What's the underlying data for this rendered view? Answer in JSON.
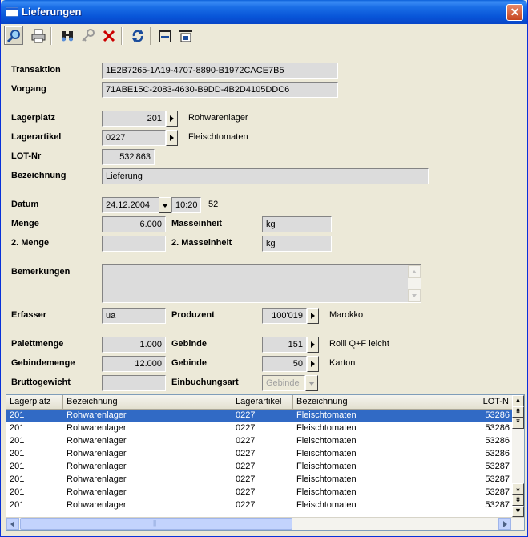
{
  "window": {
    "title": "Lieferungen",
    "close": "✕"
  },
  "toolbar": {
    "buttons": [
      "search-icon",
      "print-icon",
      "binoculars-icon",
      "key-icon",
      "delete-icon",
      "refresh-icon",
      "split-icon",
      "import-icon"
    ]
  },
  "form": {
    "transaktion_label": "Transaktion",
    "transaktion_value": "1E2B7265-1A19-4707-8890-B1972CACE7B5",
    "vorgang_label": "Vorgang",
    "vorgang_value": "71ABE15C-2083-4630-B9DD-4B2D4105DDC6",
    "lagerplatz_label": "Lagerplatz",
    "lagerplatz_value": "201",
    "lagerplatz_desc": "Rohwarenlager",
    "lagerartikel_label": "Lagerartikel",
    "lagerartikel_value": "0227",
    "lagerartikel_desc": "Fleischtomaten",
    "lot_label": "LOT-Nr",
    "lot_value": "532'863",
    "bezeichnung_label": "Bezeichnung",
    "bezeichnung_value": "Lieferung",
    "datum_label": "Datum",
    "datum_value": "24.12.2004",
    "zeit_value": "10:20",
    "week_value": "52",
    "menge_label": "Menge",
    "menge_value": "6.000",
    "masseinheit_label": "Masseinheit",
    "masseinheit_value": "kg",
    "menge2_label": "2. Menge",
    "menge2_value": "",
    "masseinheit2_label": "2. Masseinheit",
    "masseinheit2_value": "kg",
    "bemerkungen_label": "Bemerkungen",
    "bemerkungen_value": "",
    "erfasser_label": "Erfasser",
    "erfasser_value": "ua",
    "produzent_label": "Produzent",
    "produzent_value": "100'019",
    "produzent_desc": "Marokko",
    "palettmenge_label": "Palettmenge",
    "palettmenge_value": "1.000",
    "gebinde1_label": "Gebinde",
    "gebinde1_value": "151",
    "gebinde1_desc": "Rolli Q+F leicht",
    "gebindemenge_label": "Gebindemenge",
    "gebindemenge_value": "12.000",
    "gebinde2_label": "Gebinde",
    "gebinde2_value": "50",
    "gebinde2_desc": "Karton",
    "bruttogewicht_label": "Bruttogewicht",
    "bruttogewicht_value": "",
    "einbuchungsart_label": "Einbuchungsart",
    "einbuchungsart_value": "Gebinde"
  },
  "grid": {
    "columns": [
      "Lagerplatz",
      "Bezeichnung",
      "Lagerartikel",
      "Bezeichnung",
      "LOT-N"
    ],
    "rows": [
      [
        "201",
        "Rohwarenlager",
        "0227",
        "Fleischtomaten",
        "53286"
      ],
      [
        "201",
        "Rohwarenlager",
        "0227",
        "Fleischtomaten",
        "53286"
      ],
      [
        "201",
        "Rohwarenlager",
        "0227",
        "Fleischtomaten",
        "53286"
      ],
      [
        "201",
        "Rohwarenlager",
        "0227",
        "Fleischtomaten",
        "53286"
      ],
      [
        "201",
        "Rohwarenlager",
        "0227",
        "Fleischtomaten",
        "53287"
      ],
      [
        "201",
        "Rohwarenlager",
        "0227",
        "Fleischtomaten",
        "53287"
      ],
      [
        "201",
        "Rohwarenlager",
        "0227",
        "Fleischtomaten",
        "53287"
      ],
      [
        "201",
        "Rohwarenlager",
        "0227",
        "Fleischtomaten",
        "53287"
      ]
    ],
    "selected_row": 0
  },
  "colors": {
    "selection": "#316ac5",
    "titlebar": "#0855d8",
    "window_bg": "#ece9d8"
  }
}
